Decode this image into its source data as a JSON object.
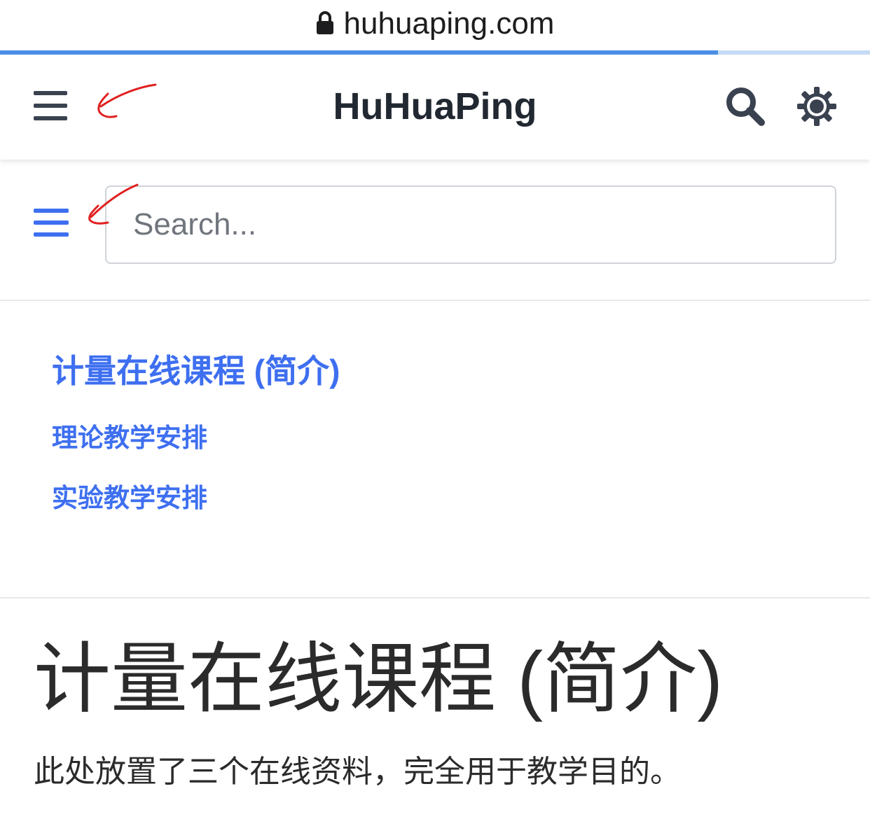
{
  "browser": {
    "url": "huhuaping.com",
    "load_progress_percent": 82.5
  },
  "navbar": {
    "brand": "HuHuaPing",
    "icons": [
      "menu-icon",
      "search-icon",
      "gear-icon"
    ]
  },
  "sidebar": {
    "search_placeholder": "Search...",
    "menu_title": "计量在线课程 (简介)",
    "items": [
      {
        "label": "理论教学安排"
      },
      {
        "label": "实验教学安排"
      }
    ]
  },
  "content": {
    "title": "计量在线课程 (简介)",
    "description": "此处放置了三个在线资料，完全用于教学目的。"
  },
  "colors": {
    "accent": "#3e6ff0",
    "progress": "#4a8fe6",
    "annotation": "#e02020",
    "text": "#2b2b2b"
  }
}
